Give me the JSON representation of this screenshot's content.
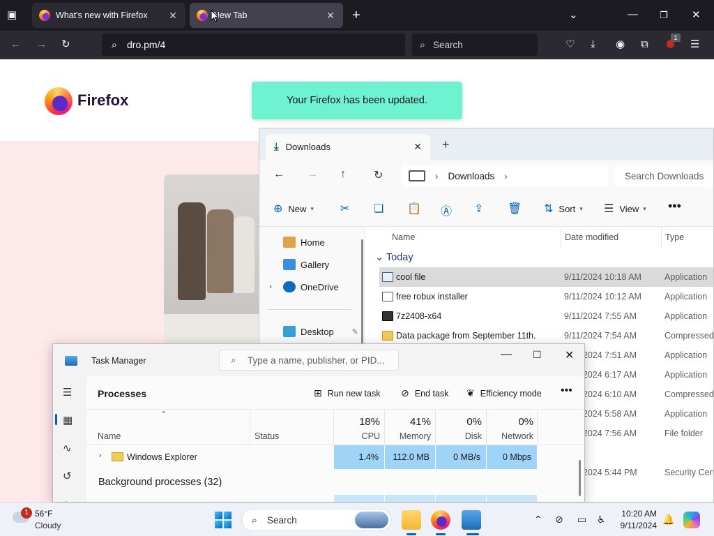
{
  "browser": {
    "tabs": [
      {
        "label": "What's new with Firefox",
        "active": false
      },
      {
        "label": "New Tab",
        "active": true
      }
    ],
    "url": "dro.pm/4",
    "search_placeholder": "Search",
    "extension_badge": "1"
  },
  "page": {
    "brand": "Firefox",
    "toast": "Your Firefox has been updated."
  },
  "explorer": {
    "tab_title": "Downloads",
    "breadcrumb": "Downloads",
    "search_placeholder": "Search Downloads",
    "commands": {
      "new": "New",
      "sort": "Sort",
      "view": "View"
    },
    "sidebar": [
      {
        "label": "Home",
        "icon": "home-icon"
      },
      {
        "label": "Gallery",
        "icon": "gallery-icon"
      },
      {
        "label": "OneDrive",
        "icon": "cloud-icon"
      },
      {
        "label": "Desktop",
        "icon": "desktop-icon"
      }
    ],
    "columns": {
      "name": "Name",
      "date": "Date modified",
      "type": "Type"
    },
    "group": "Today",
    "files": [
      {
        "name": "cool file",
        "date": "9/11/2024 10:18 AM",
        "type": "Application"
      },
      {
        "name": "free robux installer",
        "date": "9/11/2024 10:12 AM",
        "type": "Application"
      },
      {
        "name": "7z2408-x64",
        "date": "9/11/2024 7:55 AM",
        "type": "Application"
      },
      {
        "name": "Data package from September 11th.",
        "date": "9/11/2024 7:54 AM",
        "type": "Compressed"
      },
      {
        "name": "",
        "date": "9/11/2024 7:51 AM",
        "type": "Application"
      },
      {
        "name": "",
        "date": "9/11/2024 6:17 AM",
        "type": "Application"
      },
      {
        "name": "",
        "date": "9/11/2024 6:10 AM",
        "type": "Compressed"
      },
      {
        "name": "",
        "date": "9/11/2024 5:58 AM",
        "type": "Application"
      },
      {
        "name": "",
        "date": "9/11/2024 7:56 AM",
        "type": "File folder"
      },
      {
        "name": "",
        "date": "9/11/2024 5:44 PM",
        "type": "Security Certi"
      }
    ]
  },
  "taskmanager": {
    "title": "Task Manager",
    "search_placeholder": "Type a name, publisher, or PID...",
    "section": "Processes",
    "actions": {
      "run": "Run new task",
      "end": "End task",
      "efficiency": "Efficiency mode"
    },
    "columns": {
      "name": "Name",
      "status": "Status",
      "cpu": "CPU",
      "memory": "Memory",
      "disk": "Disk",
      "network": "Network"
    },
    "totals": {
      "cpu": "18%",
      "memory": "41%",
      "disk": "0%",
      "network": "0%"
    },
    "processes": [
      {
        "name": "Windows Explorer",
        "cpu": "1.4%",
        "memory": "112.0 MB",
        "disk": "0 MB/s",
        "network": "0 Mbps"
      }
    ],
    "background_title": "Background processes (32)"
  },
  "taskbar": {
    "weather_temp": "56°F",
    "weather_cond": "Cloudy",
    "weather_badge": "1",
    "search": "Search",
    "time": "10:20 AM",
    "date": "9/11/2024"
  }
}
